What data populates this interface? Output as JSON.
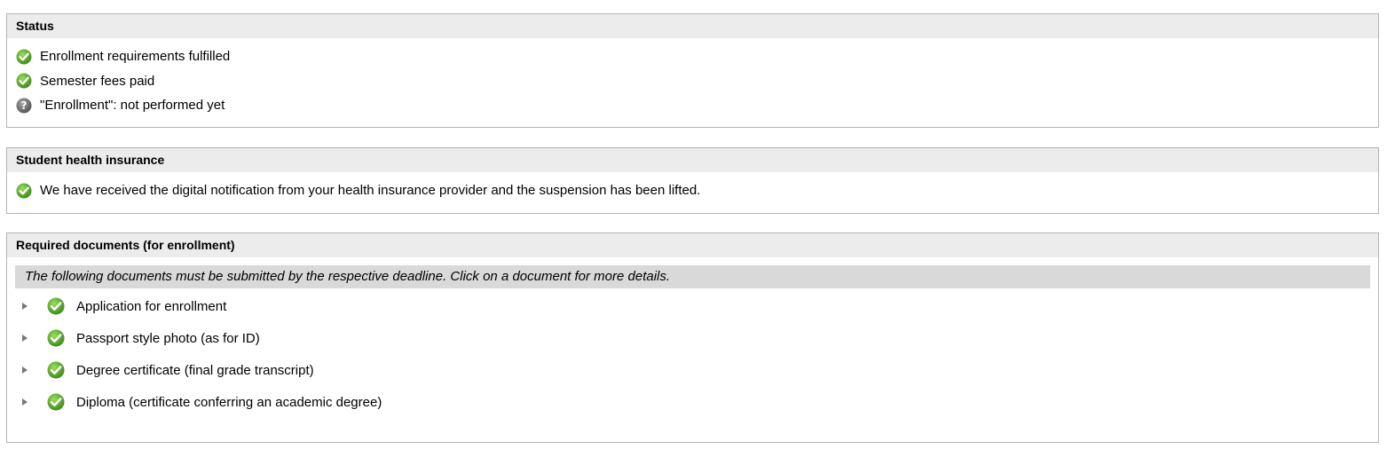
{
  "status": {
    "title": "Status",
    "items": [
      {
        "icon": "check-icon",
        "text": "Enrollment requirements fulfilled"
      },
      {
        "icon": "check-icon",
        "text": "Semester fees paid"
      },
      {
        "icon": "question-icon",
        "text": "\"Enrollment\": not performed yet"
      }
    ]
  },
  "insurance": {
    "title": "Student health insurance",
    "items": [
      {
        "icon": "check-icon",
        "text": "We have received the digital notification from your health insurance provider and the suspension has been lifted."
      }
    ]
  },
  "documents": {
    "title": "Required documents (for enrollment)",
    "note": "The following documents must be submitted by the respective deadline. Click on a document for more details.",
    "items": [
      {
        "icon": "check-icon",
        "label": "Application for enrollment"
      },
      {
        "icon": "check-icon",
        "label": "Passport style photo (as for ID)"
      },
      {
        "icon": "check-icon",
        "label": "Degree certificate (final grade transcript)"
      },
      {
        "icon": "check-icon",
        "label": "Diploma (certificate conferring an academic degree)"
      }
    ]
  },
  "colors": {
    "check_green": "#5aa02c",
    "question_gray": "#6b6b6b",
    "header_bg": "#ececec",
    "note_bg": "#d9d9d9"
  }
}
